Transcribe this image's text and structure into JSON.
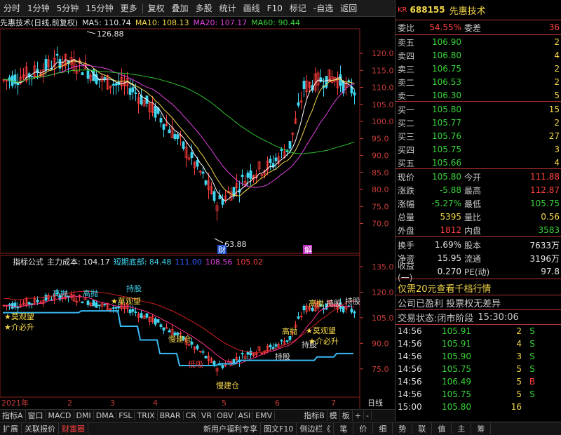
{
  "toolbar": [
    "分时",
    "1分钟",
    "5分钟",
    "15分钟",
    "更多",
    "复权",
    "叠加",
    "多股",
    "统计",
    "画线",
    "F10",
    "标记",
    "-自选",
    "返回"
  ],
  "main_header": {
    "title": "先惠技术(日线,前复权)",
    "ma5": "MA5: 110.74",
    "ma10": "MA10: 108.13",
    "ma20": "MA20: 107.17",
    "ma60": "MA60: 90.44"
  },
  "price_axis": [
    "120.0",
    "115.0",
    "110.0",
    "105.0",
    "100.0",
    "95.0",
    "90.0",
    "85.0",
    "80.0",
    "75.0",
    "70.0"
  ],
  "annotations": {
    "high": "126.88",
    "low": "63.88",
    "cai": "财",
    "jie": "解"
  },
  "sub_header": {
    "name": "指标公式",
    "cost": "主力成本: 104.17",
    "bottom": "短期底部: 84.48",
    "v1": "111.00",
    "v2": "108.56",
    "v3": "105.02"
  },
  "sub_axis": [
    "135.0",
    "120.0",
    "105.0",
    "90.0",
    "75.0"
  ],
  "sub_labels": [
    "★莫观望",
    "★介必升",
    "★莫观望",
    "高抛",
    "持股",
    "低吸",
    "慢建仓",
    "慢建仓",
    "持股",
    "高抛",
    "持股",
    "★莫观望",
    "★介必升",
    "高抛",
    "持股",
    "高抛",
    "持股"
  ],
  "date_axis": [
    "2021年",
    "2",
    "3",
    "4",
    "5",
    "6",
    "7",
    "日线"
  ],
  "tabs": [
    "指标A",
    "窗口",
    "MACD",
    "DMI",
    "DMA",
    "FSL",
    "TRIX",
    "BRAR",
    "CR",
    "VR",
    "OBV",
    "ASI",
    "EMV",
    "指标B",
    "模",
    "板",
    "+",
    "-"
  ],
  "bottom": [
    "扩展",
    "关联报价",
    "财富圈",
    "新用户福利专享",
    "图文F10",
    "侧边栏《",
    "笔",
    "价",
    "细",
    "势",
    "联",
    "值",
    "主",
    "筹"
  ],
  "stock": {
    "market": "KR",
    "code": "688155",
    "name": "先惠技术"
  },
  "weibi": {
    "label": "委比",
    "value": "54.55%",
    "label2": "委差",
    "value2": "36"
  },
  "sells": [
    {
      "l": "卖五",
      "p": "106.90",
      "v": "2"
    },
    {
      "l": "卖四",
      "p": "106.80",
      "v": "4"
    },
    {
      "l": "卖三",
      "p": "106.75",
      "v": "2"
    },
    {
      "l": "卖二",
      "p": "106.53",
      "v": "2"
    },
    {
      "l": "卖一",
      "p": "106.30",
      "v": "5"
    }
  ],
  "buys": [
    {
      "l": "买一",
      "p": "105.80",
      "v": "15"
    },
    {
      "l": "买二",
      "p": "105.77",
      "v": "2"
    },
    {
      "l": "买三",
      "p": "105.76",
      "v": "27"
    },
    {
      "l": "买四",
      "p": "105.75",
      "v": "3"
    },
    {
      "l": "买五",
      "p": "105.66",
      "v": "4"
    }
  ],
  "quote1": [
    {
      "a": "现价",
      "b": "105.80",
      "c": "今开",
      "d": "111.88",
      "bc": "grn",
      "dc": "red"
    },
    {
      "a": "涨跌",
      "b": "-5.88",
      "c": "最高",
      "d": "112.87",
      "bc": "grn",
      "dc": "red"
    },
    {
      "a": "涨幅",
      "b": "-5.27%",
      "c": "最低",
      "d": "105.75",
      "bc": "grn",
      "dc": "grn"
    },
    {
      "a": "总量",
      "b": "5395",
      "c": "量比",
      "d": "0.56",
      "bc": "yel",
      "dc": "yel"
    },
    {
      "a": "外盘",
      "b": "1812",
      "c": "内盘",
      "d": "3583",
      "bc": "red",
      "dc": "grn"
    }
  ],
  "quote2": [
    {
      "a": "换手",
      "b": "1.69%",
      "c": "股本",
      "d": "7633万"
    },
    {
      "a": "净资",
      "b": "15.95",
      "c": "流通",
      "d": "3196万"
    },
    {
      "a": "收益(一)",
      "b": "0.270",
      "c": "PE(动)",
      "d": "97.8"
    }
  ],
  "promo": "仅需20元查看千档行情",
  "company": "公司已盈利 投票权无差异",
  "trade_state": {
    "label": "交易状态:",
    "state": "闭市阶段",
    "time": "15:30:06"
  },
  "ticks": [
    {
      "t": "14:56",
      "p": "105.91",
      "v": "2",
      "d": "S"
    },
    {
      "t": "14:56",
      "p": "105.91",
      "v": "4",
      "d": "S"
    },
    {
      "t": "14:56",
      "p": "105.90",
      "v": "3",
      "d": "S"
    },
    {
      "t": "14:56",
      "p": "105.75",
      "v": "5",
      "d": "S"
    },
    {
      "t": "14:56",
      "p": "106.49",
      "v": "5",
      "d": "B"
    },
    {
      "t": "14:56",
      "p": "105.75",
      "v": "5",
      "d": "S"
    },
    {
      "t": "15:00",
      "p": "105.80",
      "v": "16",
      "d": ""
    }
  ],
  "colors": {
    "up": "#ff3c3c",
    "down": "#3fd6f0",
    "ma5": "#ffffff",
    "ma10": "#f5d84a",
    "ma20": "#e040e0",
    "ma60": "#2fc02f"
  }
}
